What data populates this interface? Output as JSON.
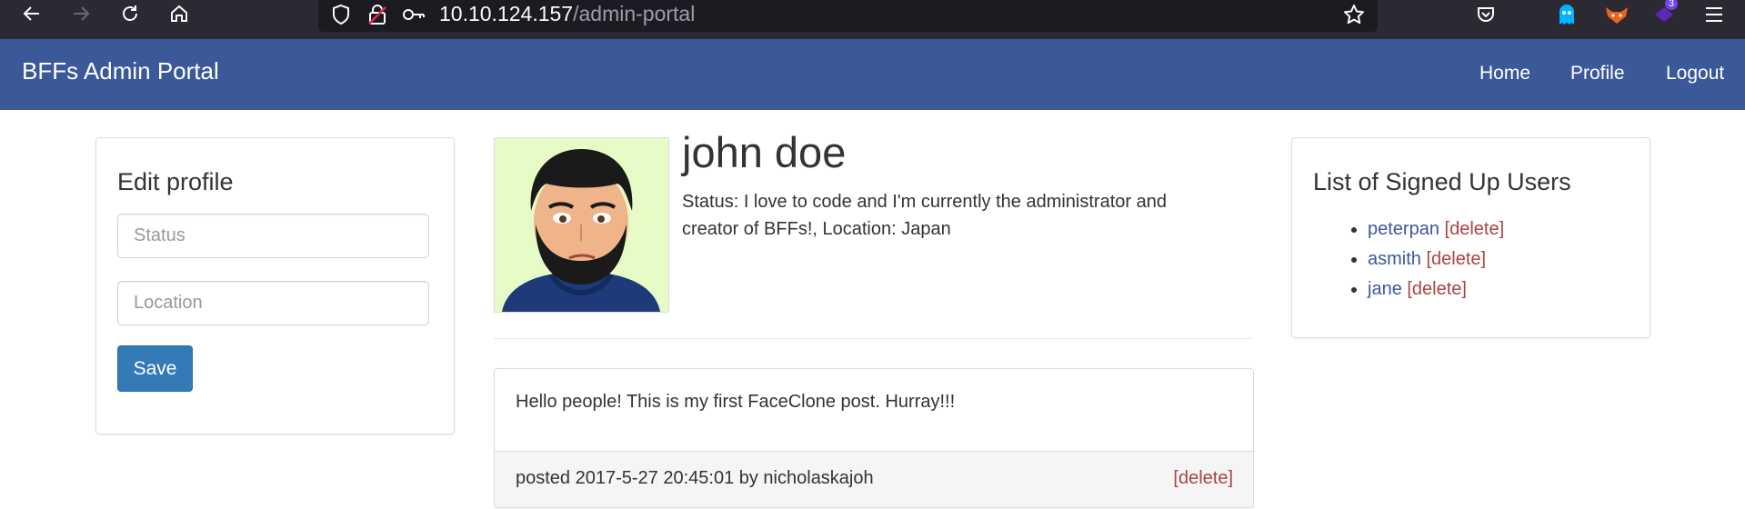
{
  "browser": {
    "url_host": "10.10.124.157",
    "url_path": "/admin-portal",
    "extension_badge": "3",
    "colors": {
      "chrome_bg": "#2b2a33",
      "urlbar_bg": "#1c1b22"
    }
  },
  "navbar": {
    "brand": "BFFs Admin Portal",
    "links": [
      "Home",
      "Profile",
      "Logout"
    ],
    "color": "#3b5998"
  },
  "edit_profile": {
    "title": "Edit profile",
    "status_placeholder": "Status",
    "location_placeholder": "Location",
    "save_label": "Save"
  },
  "profile": {
    "name": "john doe",
    "status_text": "Status: I love to code and I'm currently the administrator and creator of BFFs!, Location: Japan"
  },
  "post": {
    "body": "Hello people! This is my first FaceClone post. Hurray!!!",
    "meta": "posted 2017-5-27 20:45:01 by nicholaskajoh",
    "delete_label": "[delete]"
  },
  "users": {
    "title": "List of Signed Up Users",
    "items": [
      {
        "name": "peterpan",
        "delete": "[delete]"
      },
      {
        "name": "asmith",
        "delete": "[delete]"
      },
      {
        "name": "jane",
        "delete": "[delete]"
      }
    ]
  }
}
